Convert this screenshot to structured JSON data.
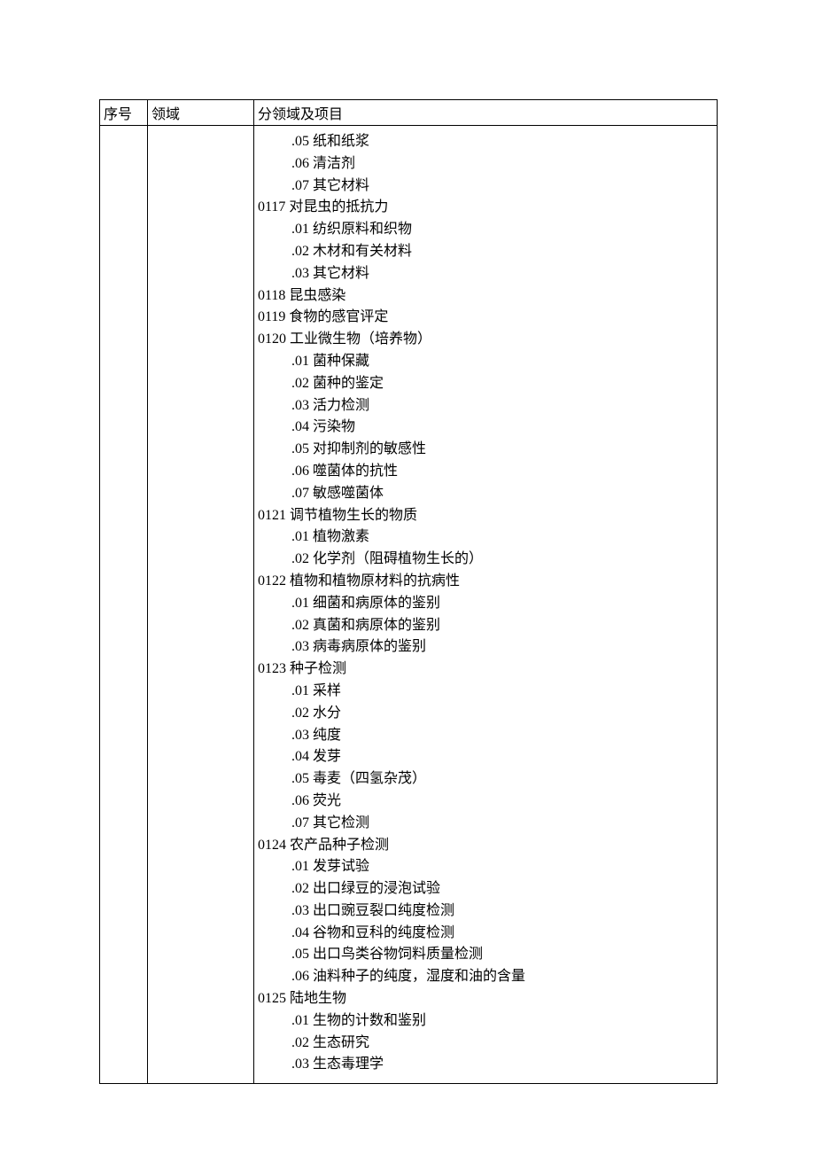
{
  "headers": {
    "seq": "序号",
    "domain": "领域",
    "content": "分领域及项目"
  },
  "entries": [
    {
      "indent": 1,
      "text": ".05 纸和纸浆"
    },
    {
      "indent": 1,
      "text": ".06 清洁剂"
    },
    {
      "indent": 1,
      "text": ".07 其它材料"
    },
    {
      "indent": 0,
      "text": "0117 对昆虫的抵抗力"
    },
    {
      "indent": 1,
      "text": ".01 纺织原料和织物"
    },
    {
      "indent": 1,
      "text": ".02 木材和有关材料"
    },
    {
      "indent": 1,
      "text": ".03 其它材料"
    },
    {
      "indent": 0,
      "text": "0118 昆虫感染"
    },
    {
      "indent": 0,
      "text": "0119 食物的感官评定"
    },
    {
      "indent": 0,
      "text": "0120 工业微生物（培养物）"
    },
    {
      "indent": 1,
      "text": ".01  菌种保藏"
    },
    {
      "indent": 1,
      "text": ".02  菌种的鉴定"
    },
    {
      "indent": 1,
      "text": ".03 活力检测"
    },
    {
      "indent": 1,
      "text": ".04 污染物"
    },
    {
      "indent": 1,
      "text": ".05 对抑制剂的敏感性"
    },
    {
      "indent": 1,
      "text": ".06 噬菌体的抗性"
    },
    {
      "indent": 1,
      "text": ".07 敏感噬菌体"
    },
    {
      "indent": 0,
      "text": "0121 调节植物生长的物质"
    },
    {
      "indent": 1,
      "text": ".01 植物激素"
    },
    {
      "indent": 1,
      "text": ".02 化学剂（阻碍植物生长的）"
    },
    {
      "indent": 0,
      "text": "0122 植物和植物原材料的抗病性"
    },
    {
      "indent": 1,
      "text": ".01 细菌和病原体的鉴别"
    },
    {
      "indent": 1,
      "text": ".02 真菌和病原体的鉴别"
    },
    {
      "indent": 1,
      "text": ".03 病毒病原体的鉴别"
    },
    {
      "indent": 0,
      "text": "0123 种子检测"
    },
    {
      "indent": 1,
      "text": ".01 采样"
    },
    {
      "indent": 1,
      "text": ".02 水分"
    },
    {
      "indent": 1,
      "text": ".03 纯度"
    },
    {
      "indent": 1,
      "text": ".04 发芽"
    },
    {
      "indent": 1,
      "text": ".05 毒麦（四氢杂茂）"
    },
    {
      "indent": 1,
      "text": ".06 荧光"
    },
    {
      "indent": 1,
      "text": ".07 其它检测"
    },
    {
      "indent": 0,
      "text": "0124 农产品种子检测"
    },
    {
      "indent": 1,
      "text": ".01 发芽试验"
    },
    {
      "indent": 1,
      "text": ".02 出口绿豆的浸泡试验"
    },
    {
      "indent": 1,
      "text": ".03 出口豌豆裂口纯度检测"
    },
    {
      "indent": 1,
      "text": ".04 谷物和豆科的纯度检测"
    },
    {
      "indent": 1,
      "text": ".05 出口鸟类谷物饲料质量检测"
    },
    {
      "indent": 1,
      "text": ".06 油料种子的纯度，湿度和油的含量"
    },
    {
      "indent": 0,
      "text": "0125 陆地生物"
    },
    {
      "indent": 1,
      "text": ".01 生物的计数和鉴别"
    },
    {
      "indent": 1,
      "text": ".02 生态研究"
    },
    {
      "indent": 1,
      "text": ".03 生态毒理学"
    }
  ]
}
